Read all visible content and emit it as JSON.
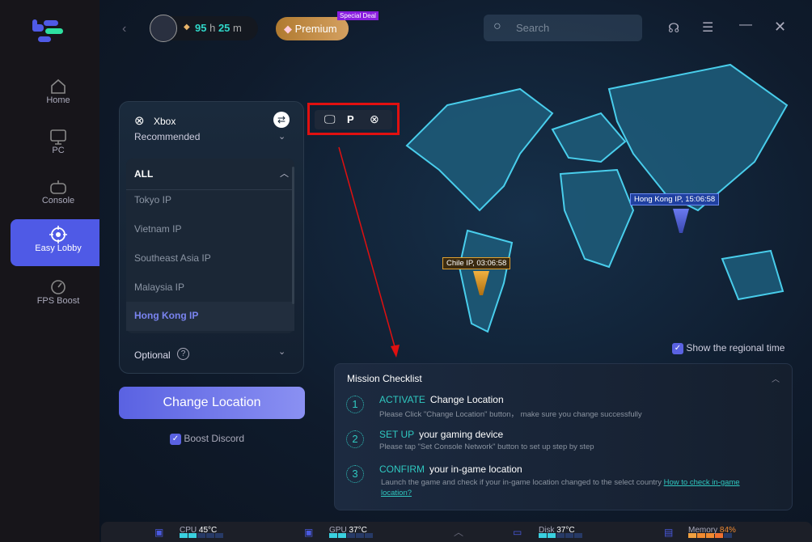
{
  "sidebar": {
    "items": [
      {
        "label": "Home",
        "icon": "home-icon"
      },
      {
        "label": "PC",
        "icon": "monitor-icon"
      },
      {
        "label": "Console",
        "icon": "gamepad-icon"
      },
      {
        "label": "Easy Lobby",
        "icon": "target-icon",
        "active": true
      },
      {
        "label": "FPS Boost",
        "icon": "speedometer-icon"
      }
    ]
  },
  "header": {
    "time_hours": "95",
    "time_h": "h",
    "time_minutes": "25",
    "time_m": "m",
    "premium": "Premium",
    "special_deal": "Special Deal",
    "search_placeholder": "Search"
  },
  "panel": {
    "platform": "Xbox",
    "recommended": "Recommended",
    "all": "ALL",
    "servers": [
      "Tokyo IP",
      "Vietnam IP",
      "Southeast Asia IP",
      "Malaysia IP",
      "Hong Kong IP"
    ],
    "selected": "Hong Kong IP",
    "optional": "Optional"
  },
  "change_location": "Change Location",
  "boost_discord": {
    "label": "Boost Discord",
    "checked": true
  },
  "map": {
    "markers": [
      {
        "label": "Hong Kong IP, 15:06:58"
      },
      {
        "label": "Chile IP, 03:06:58"
      }
    ],
    "show_regional_time": {
      "label": "Show the regional time",
      "checked": true
    }
  },
  "mission": {
    "title": "Mission Checklist",
    "steps": [
      {
        "num": "1",
        "key": "ACTIVATE",
        "title": "Change Location",
        "desc": "Please Click \"Change Location\" button， make sure you change successfully"
      },
      {
        "num": "2",
        "key": "SET UP",
        "title": "your gaming device",
        "desc": "Please tap \"Set Console Network\" button to set up step by step"
      },
      {
        "num": "3",
        "key": "CONFIRM",
        "title": "your in-game location",
        "desc": "Launch the game and check if your in-game location changed to the select country",
        "link": "How to check in-game location?"
      }
    ]
  },
  "stats": {
    "cpu": {
      "label": "CPU",
      "value": "45°C"
    },
    "gpu": {
      "label": "GPU",
      "value": "37°C"
    },
    "disk": {
      "label": "Disk",
      "value": "37°C"
    },
    "memory": {
      "label": "Memory",
      "value": "84%"
    }
  },
  "colors": {
    "accent": "#5a62e2",
    "teal": "#2fc8c0",
    "premium": "#c48a3c",
    "highlight": "#e01010",
    "memory": "#f08a30"
  }
}
